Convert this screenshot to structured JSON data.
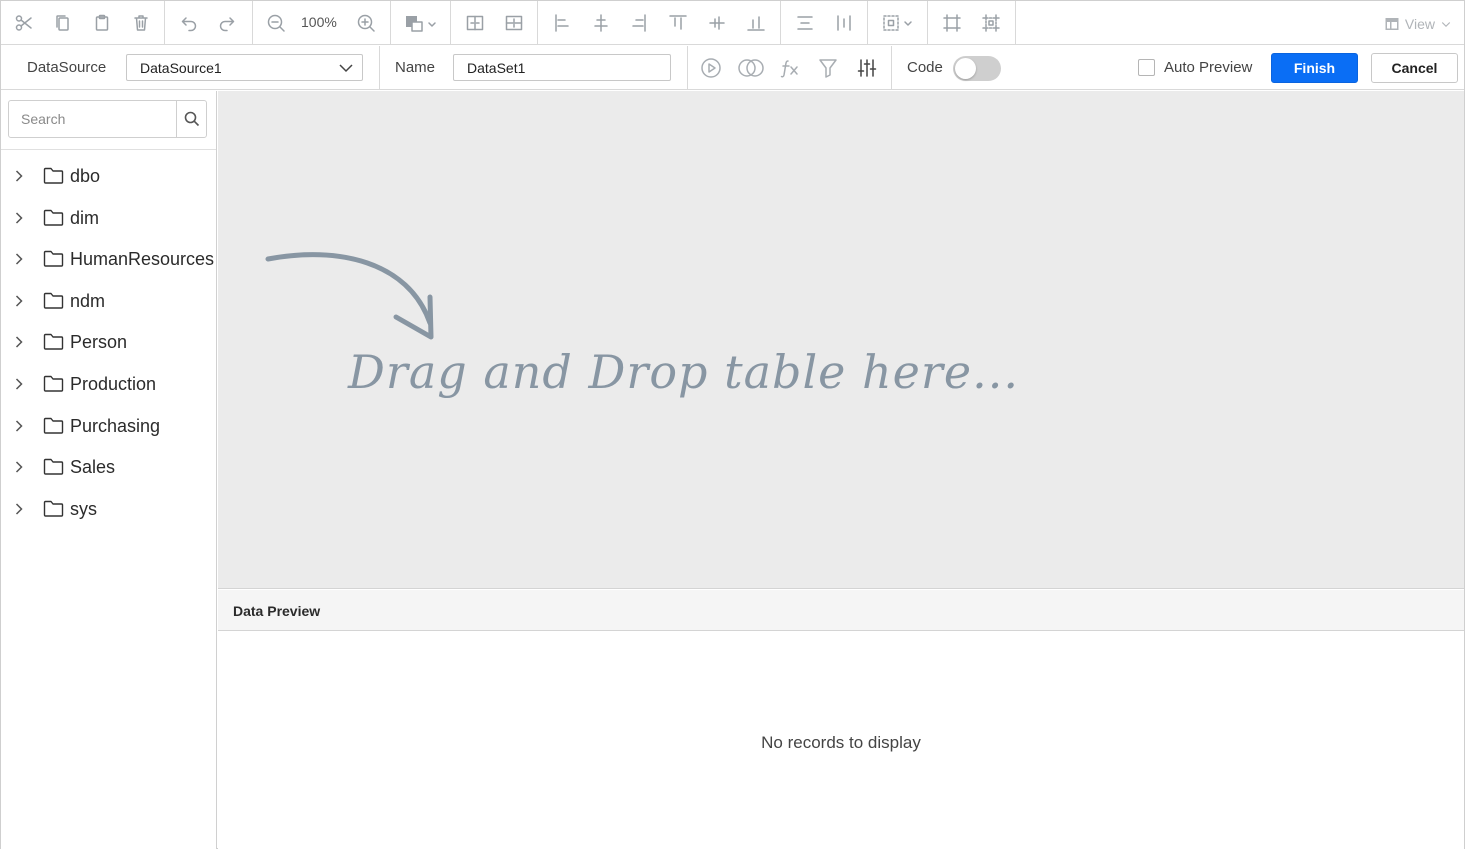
{
  "toolbar": {
    "zoom": "100%",
    "view_label": "View",
    "icons": [
      "cut-icon",
      "copy-icon",
      "paste-icon",
      "delete-icon",
      "undo-icon",
      "redo-icon",
      "zoom-out-icon",
      "zoom-in-icon",
      "shapes-icon",
      "split-h-icon",
      "split-v-icon",
      "align-left-icon",
      "align-center-icon",
      "align-right-icon",
      "align-top-icon",
      "align-middle-icon",
      "align-bottom-icon",
      "distribute-h-icon",
      "distribute-v-icon",
      "group-icon",
      "fit-icon",
      "layout-icon",
      "view-icon"
    ]
  },
  "datasource": {
    "label": "DataSource",
    "selected": "DataSource1"
  },
  "dataset": {
    "label": "Name",
    "value": "DataSet1"
  },
  "query_tools": {
    "icons": [
      "run-icon",
      "join-icon",
      "expression-icon",
      "filter-icon",
      "parameters-icon"
    ]
  },
  "code_toggle": {
    "label": "Code",
    "on": false
  },
  "auto_preview": {
    "label": "Auto Preview",
    "checked": false
  },
  "buttons": {
    "finish": "Finish",
    "cancel": "Cancel"
  },
  "sidebar": {
    "search_placeholder": "Search",
    "schemas": [
      "dbo",
      "dim",
      "HumanResources",
      "ndm",
      "Person",
      "Production",
      "Purchasing",
      "Sales",
      "sys"
    ]
  },
  "canvas": {
    "hint": "Drag and Drop table here..."
  },
  "preview": {
    "title": "Data Preview",
    "empty_message": "No records to display"
  },
  "colors": {
    "accent": "#0a6ef5",
    "canvas_bg": "#ebebeb",
    "hint_text": "#8896a3"
  }
}
